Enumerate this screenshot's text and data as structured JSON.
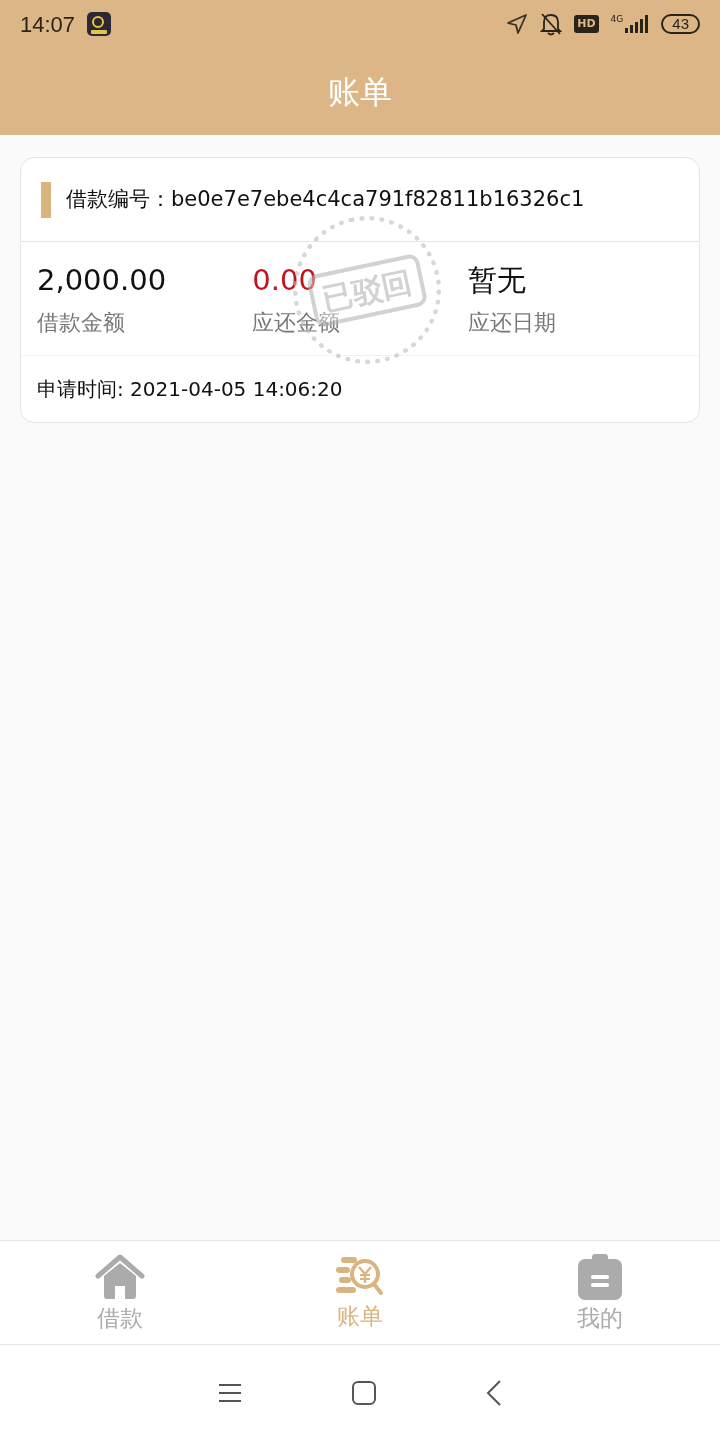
{
  "status_bar": {
    "time": "14:07",
    "network": "4G",
    "hd": "HD",
    "battery": "43"
  },
  "header": {
    "title": "账单"
  },
  "bill": {
    "number_label": "借款编号：",
    "number": "be0e7e7ebe4c4ca791f82811b16326c1",
    "stats": [
      {
        "value": "2,000.00",
        "label": "借款金额",
        "color": "#111111"
      },
      {
        "value": "0.00",
        "label": "应还金额",
        "color": "#c0141c"
      },
      {
        "value": "暂无",
        "label": "应还日期",
        "color": "#111111"
      }
    ],
    "stamp": "已驳回",
    "apply_time": "申请时间: 2021-04-05 14:06:20"
  },
  "tabs": [
    {
      "kind": "home",
      "label": "借款",
      "selected": false
    },
    {
      "kind": "bill",
      "label": "账单",
      "selected": true
    },
    {
      "kind": "mine",
      "label": "我的",
      "selected": false
    }
  ]
}
